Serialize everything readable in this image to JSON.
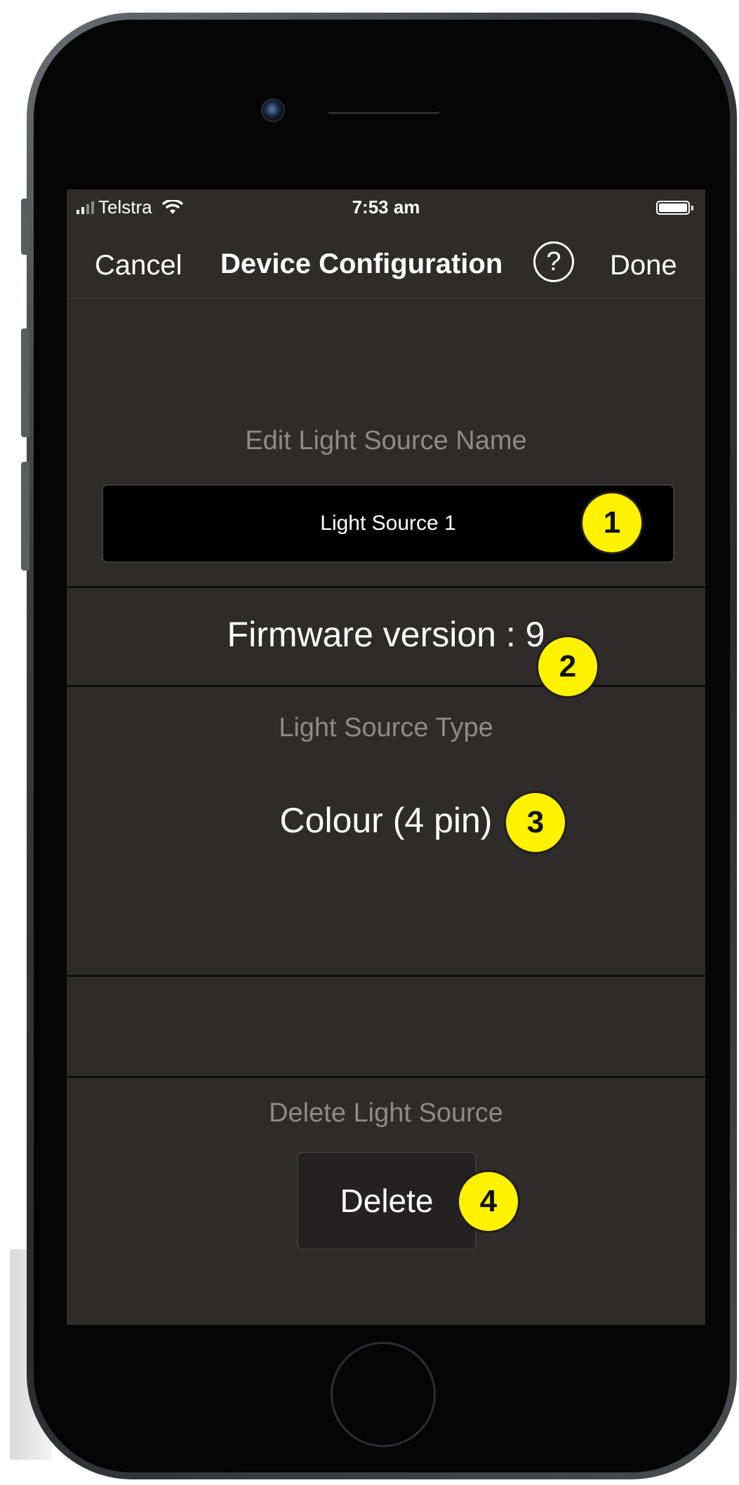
{
  "status_bar": {
    "carrier": "Telstra",
    "time": "7:53 am",
    "battery_level_percent": 100
  },
  "nav_bar": {
    "cancel_label": "Cancel",
    "title": "Device Configuration",
    "help_label": "?",
    "done_label": "Done"
  },
  "light_source_name": {
    "section_label": "Edit Light Source Name",
    "value": "Light Source 1"
  },
  "firmware": {
    "text": "Firmware version : 9"
  },
  "light_source_type": {
    "section_label": "Light Source Type",
    "value": "Colour (4 pin)"
  },
  "delete_section": {
    "section_label": "Delete Light Source",
    "button_label": "Delete"
  },
  "annotation_badges": [
    "1",
    "2",
    "3",
    "4"
  ],
  "colors": {
    "screen_background": "#2f2b2a",
    "badge_fill": "#fff200",
    "label_gray": "#8e8a89"
  }
}
